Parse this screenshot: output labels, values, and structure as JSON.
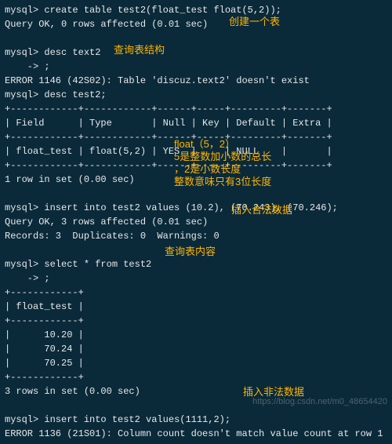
{
  "terminal": {
    "lines": [
      "mysql> create table test2(float_test float(5,2));",
      "Query OK, 0 rows affected (0.01 sec)",
      "",
      "mysql> desc text2",
      "    -> ;",
      "ERROR 1146 (42S02): Table 'discuz.text2' doesn't exist",
      "mysql> desc test2;",
      "+------------+------------+------+-----+---------+-------+",
      "| Field      | Type       | Null | Key | Default | Extra |",
      "+------------+------------+------+-----+---------+-------+",
      "| float_test | float(5,2) | YES  |     | NULL    |       |",
      "+------------+------------+------+-----+---------+-------+",
      "1 row in set (0.00 sec)",
      "",
      "mysql> insert into test2 values (10.2), (70.243), (70.246);",
      "Query OK, 3 rows affected (0.01 sec)",
      "Records: 3  Duplicates: 0  Warnings: 0",
      "",
      "mysql> select * from test2",
      "    -> ;",
      "+------------+",
      "| float_test |",
      "+------------+",
      "|      10.20 |",
      "|      70.24 |",
      "|      70.25 |",
      "+------------+",
      "3 rows in set (0.00 sec)",
      "",
      "mysql> insert into test2 values(1111,2);",
      "ERROR 1136 (21S01): Column count doesn't match value count at row 1"
    ]
  },
  "annotations": {
    "create_table": "创建一个表",
    "desc_struct": "查询表结构",
    "float_def": "float（5，2）",
    "float_line1": "5是整数加小数的总长",
    "float_line2": "，2是小数长度",
    "float_line3": "整数意味只有3位长度",
    "insert_legal": "插入合法数据",
    "select_content": "查询表内容",
    "insert_illegal": "插入非法数据"
  },
  "watermark": "https://blog.csdn.net/m0_48654420"
}
